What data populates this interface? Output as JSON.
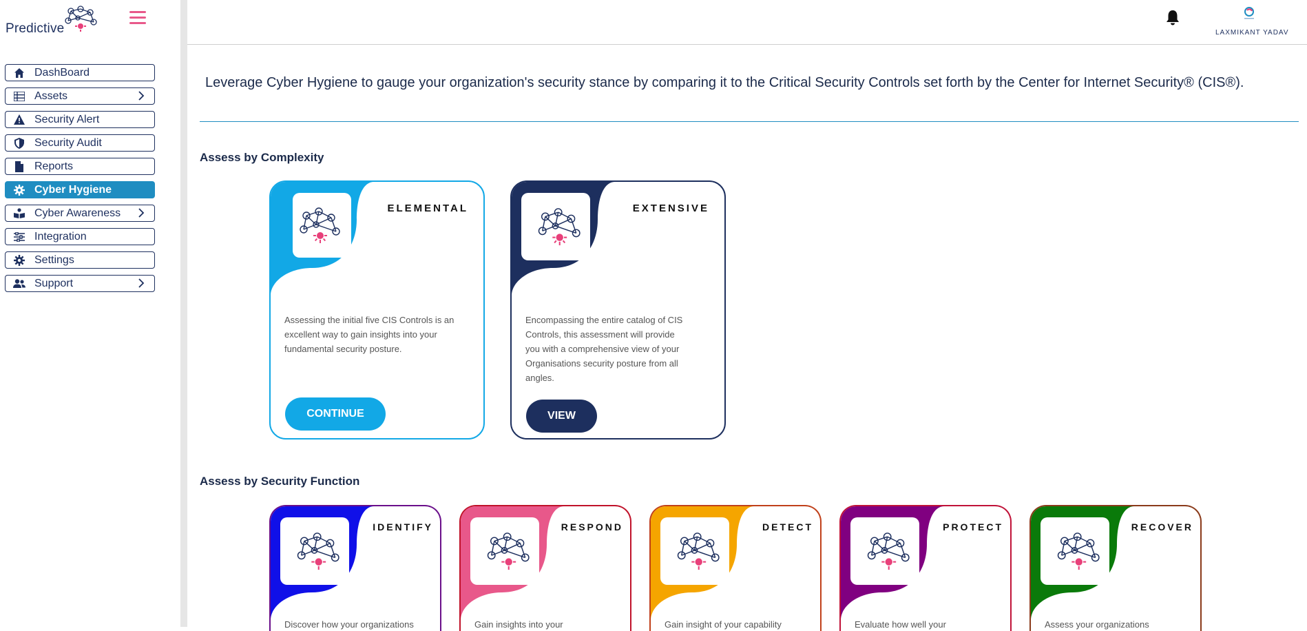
{
  "brand": {
    "name": "Predictive"
  },
  "sidebar": {
    "items": [
      {
        "label": "DashBoard",
        "icon": "home-icon",
        "chevron": false,
        "active": false
      },
      {
        "label": "Assets",
        "icon": "list-icon",
        "chevron": true,
        "active": false
      },
      {
        "label": "Security Alert",
        "icon": "warning-icon",
        "chevron": false,
        "active": false
      },
      {
        "label": "Security Audit",
        "icon": "shield-icon",
        "chevron": false,
        "active": false
      },
      {
        "label": "Reports",
        "icon": "document-icon",
        "chevron": false,
        "active": false
      },
      {
        "label": "Cyber Hygiene",
        "icon": "gear-icon",
        "chevron": false,
        "active": true
      },
      {
        "label": "Cyber Awareness",
        "icon": "reader-icon",
        "chevron": true,
        "active": false
      },
      {
        "label": "Integration",
        "icon": "sliders-icon",
        "chevron": false,
        "active": false
      },
      {
        "label": "Settings",
        "icon": "gear-icon",
        "chevron": false,
        "active": false
      },
      {
        "label": "Support",
        "icon": "users-icon",
        "chevron": true,
        "active": false
      }
    ]
  },
  "header": {
    "username": "LAXMIKANT YADAV"
  },
  "main": {
    "intro": "Leverage Cyber Hygiene to gauge your organization's security stance by comparing it to the Critical Security Controls set forth by the Center for Internet Security® (CIS®).",
    "complexity_title": "Assess by Complexity",
    "function_title": "Assess by Security Function",
    "complexity_cards": [
      {
        "title": "ELEMENTAL",
        "desc": "Assessing the initial five CIS Controls is an excellent way to gain insights into your fundamental security posture.",
        "button": "CONTINUE",
        "color": "#12a8e6"
      },
      {
        "title": "EXTENSIVE",
        "desc": "Encompassing the entire catalog of CIS Controls, this assessment will provide you with a comprehensive view of your Organisations security posture from all angles.",
        "button": "VIEW",
        "color": "#1d2f5e"
      }
    ],
    "function_cards": [
      {
        "title": "IDENTIFY",
        "desc": "Discover how your organizations",
        "color": "#1010e8",
        "border": "#6a0f8a"
      },
      {
        "title": "RESPOND",
        "desc": "Gain insights into your",
        "color": "#e8588a",
        "border": "#c0122a"
      },
      {
        "title": "DETECT",
        "desc": "Gain insight of your capability",
        "color": "#f5a500",
        "border": "#c0401a"
      },
      {
        "title": "PROTECT",
        "desc": "Evaluate how well your",
        "color": "#800080",
        "border": "#c01238"
      },
      {
        "title": "RECOVER",
        "desc": "Assess your organizations",
        "color": "#0a7a0a",
        "border": "#8a3a1a"
      }
    ]
  }
}
